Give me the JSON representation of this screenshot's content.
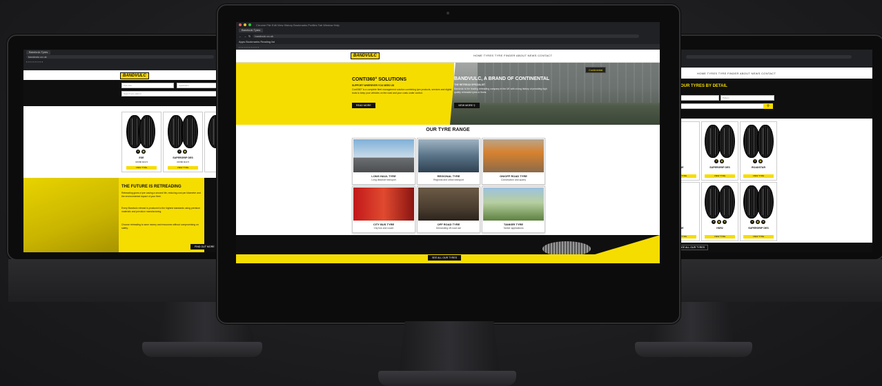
{
  "brand": {
    "logo": "BANDVULC",
    "yellow": "#f6dd00",
    "black": "#0f0f0f"
  },
  "center": {
    "browser": {
      "tab": "Bandvulc Tyres",
      "url": "bandvulc.co.uk",
      "bookmarks": "Apps   Bookmarks   Reading list"
    },
    "nav": "HOME  TYRES  TYRE FINDER  ABOUT  NEWS  CONTACT",
    "hero_left": {
      "title": "CONTI360° SOLUTIONS",
      "subtitle": "SUPPORT WHEREVER YOU NEED US",
      "body": "Conti360° is a complete fleet management solution combining tyre products, services and digital tools to keep your vehicles on the road and your costs under control.",
      "button": "READ MORE"
    },
    "hero_right": {
      "title": "BANDVULC, A BRAND OF CONTINENTAL",
      "subtitle": "THE RETREAD SPECIALIST",
      "body": "Bandvulc is the leading retreading company in the UK with a long history of providing high quality retreaded tyres to fleets.",
      "button": "VIEW MORE",
      "sign": "Continental"
    },
    "range": {
      "title": "OUR TYRE RANGE",
      "cards": [
        {
          "title": "LONG HAUL TYRE",
          "sub": "Long distance transport"
        },
        {
          "title": "REGIONAL TYRE",
          "sub": "Regional and urban transport"
        },
        {
          "title": "ON/OFF ROAD TYRE",
          "sub": "Construction and quarry"
        },
        {
          "title": "CITY BUS TYRE",
          "sub": "City bus and coach"
        },
        {
          "title": "OFF ROAD TYRE",
          "sub": "Demanding off-road use"
        },
        {
          "title": "TANKER TYRE",
          "sub": "Tanker applications"
        }
      ]
    },
    "footer_button": "SEE ALL OUR TYRES"
  },
  "left": {
    "browser": {
      "tab": "Bandvulc Tyres",
      "url": "bandvulc.co.uk"
    },
    "search": {
      "field1": "Tyre size",
      "field2": "Application",
      "field3": "Search tyre pattern"
    },
    "tyres": [
      {
        "name": "ESE",
        "sub": "315/80 R22.5"
      },
      {
        "name": "SUPERGRIP DES",
        "sub": "315/80 R22.5"
      }
    ],
    "retread": {
      "title": "THE FUTURE IS RETREADING",
      "p1": "Retreading gives a tyre casing a second life, reducing cost per kilometre and the environmental impact of your fleet.",
      "p2": "Every Bandvulc retread is produced to the highest standards using premium materials and precision manufacturing.",
      "p3": "Choose retreading to save money and resources without compromising on safety.",
      "button": "FIND OUT MORE"
    },
    "tyre_button": "VIEW TYRE"
  },
  "right": {
    "nav": "HOME  TYRES  TYRE FINDER  ABOUT  NEWS  CONTACT",
    "heading": "YOUR TYRES BY DETAIL",
    "search": {
      "field1": "Tyre size",
      "field2": "Pattern"
    },
    "tyres": [
      {
        "name": "ESE",
        "sub": ""
      },
      {
        "name": "SUPERGRIP DES",
        "sub": ""
      },
      {
        "name": "ROADSTAR",
        "sub": ""
      },
      {
        "name": "ESE",
        "sub": ""
      },
      {
        "name": "HSR2",
        "sub": ""
      },
      {
        "name": "SUPERGRIP DES",
        "sub": ""
      }
    ],
    "tyre_button": "VIEW TYRE",
    "footer_button": "SEE ALL OUR TYRES"
  }
}
